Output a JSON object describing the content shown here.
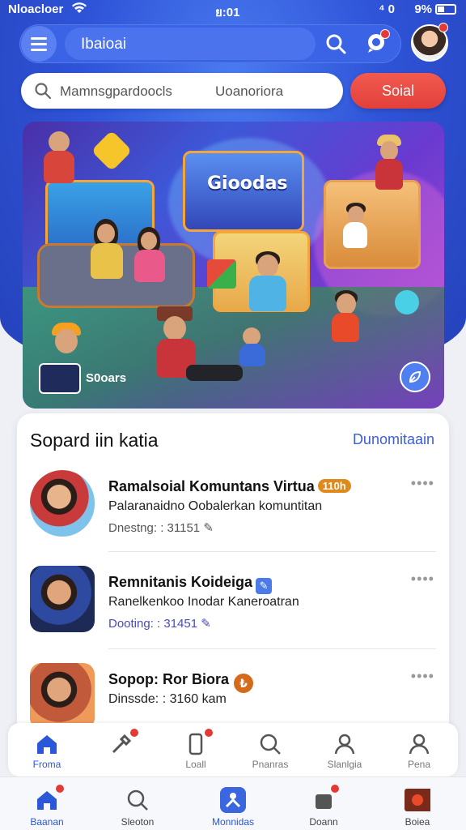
{
  "status_bar": {
    "carrier": "Nloacloer",
    "time": "ย:01",
    "battery": "9%",
    "extra": "⁴ 0"
  },
  "topbar": {
    "title": "Ibaioai"
  },
  "search": {
    "placeholder": "Mamnsgpardoocls",
    "secondary": "Uoanoriora",
    "button_label": "Soial"
  },
  "banner": {
    "panel_title": "Gioodas",
    "caption": "S0oars"
  },
  "section": {
    "title": "Sopard iin katia",
    "link": "Dunomitaain"
  },
  "items": [
    {
      "name": "Ramalsoial Komuntans Virtua",
      "tag": "110h",
      "desc": "Palaranaidno Oobalerkan komuntitan",
      "meta": "Dnestng: : 31151",
      "more": "••••"
    },
    {
      "name": "Remnitanis Koideiga",
      "desc": "Ranelkenkoo Inodar Kaneroatran",
      "meta": "Dooting: : 31451",
      "more": "••••"
    },
    {
      "name": "Sopop: Ror Biora",
      "meta": "Dinssde: : 3160 kam",
      "more": "••••"
    }
  ],
  "nav_upper": [
    {
      "label": "Froma",
      "icon": "home-icon"
    },
    {
      "label": "",
      "icon": "tools-icon"
    },
    {
      "label": "Loall",
      "icon": "phone-icon"
    },
    {
      "label": "Pnanras",
      "icon": "search-icon"
    },
    {
      "label": "Slanlgia",
      "icon": "user-icon"
    },
    {
      "label": "Pena",
      "icon": "profile-icon"
    }
  ],
  "nav_lower": [
    {
      "label": "Baanan",
      "icon": "home-icon"
    },
    {
      "label": "Sleoton",
      "icon": "search-icon"
    },
    {
      "label": "Monnidas",
      "icon": "community-icon"
    },
    {
      "label": "Doann",
      "icon": "bag-icon"
    },
    {
      "label": "Boiea",
      "icon": "game-icon"
    }
  ],
  "colors": {
    "brand_blue": "#2f54d8",
    "accent_red": "#e2403b",
    "link_blue": "#3c5fd0"
  }
}
